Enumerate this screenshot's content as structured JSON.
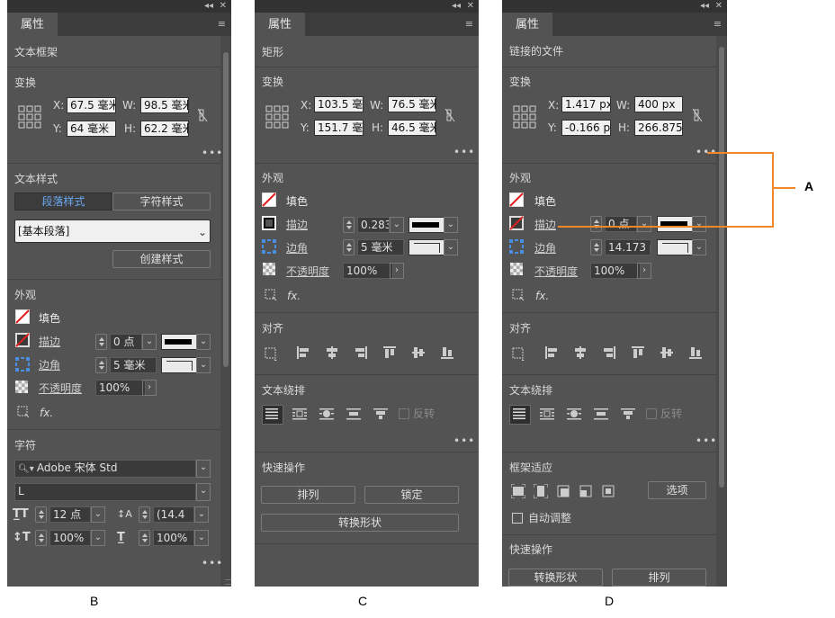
{
  "panels": {
    "b": {
      "tab": "属性",
      "object_type": "文本框架",
      "transform_label": "变换",
      "x_label": "X:",
      "x_value": "67.5 毫米",
      "y_label": "Y:",
      "y_value": "64 毫米",
      "w_label": "W:",
      "w_value": "98.5 毫米",
      "h_label": "H:",
      "h_value": "62.2 毫米",
      "more": "•••",
      "text_style_label": "文本样式",
      "para_style_tab": "段落样式",
      "char_style_tab": "字符样式",
      "style_value": "[基本段落]",
      "create_style_button": "创建样式",
      "appearance_label": "外观",
      "fill_label": "填色",
      "stroke_label": "描边",
      "stroke_value": "0 点",
      "corner_label": "边角",
      "corner_value": "5 毫米",
      "opacity_label": "不透明度",
      "opacity_value": "100%",
      "fx": "fx.",
      "character_label": "字符",
      "font_family": "Adobe 宋体 Std",
      "font_style": "L",
      "font_size": "12 点",
      "leading": "(14.4",
      "vertical_scale": "100%",
      "horizontal_scale": "100%"
    },
    "c": {
      "tab": "属性",
      "object_type": "矩形",
      "transform_label": "变换",
      "x_label": "X:",
      "x_value": "103.5 毫",
      "y_label": "Y:",
      "y_value": "151.7 毫",
      "w_label": "W:",
      "w_value": "76.5 毫米",
      "h_label": "H:",
      "h_value": "46.5 毫米",
      "more": "•••",
      "appearance_label": "外观",
      "fill_label": "填色",
      "stroke_label": "描边",
      "stroke_value": "0.283",
      "corner_label": "边角",
      "corner_value": "5 毫米",
      "opacity_label": "不透明度",
      "opacity_value": "100%",
      "fx": "fx.",
      "align_label": "对齐",
      "wrap_label": "文本绕排",
      "invert_label": "反转",
      "quick_actions_label": "快速操作",
      "arrange_button": "排列",
      "lock_button": "锁定",
      "convert_button": "转换形状"
    },
    "d": {
      "tab": "属性",
      "object_type": "链接的文件",
      "transform_label": "变换",
      "x_label": "X:",
      "x_value": "1.417 px",
      "y_label": "Y:",
      "y_value": "-0.166 p",
      "w_label": "W:",
      "w_value": "400 px",
      "h_label": "H:",
      "h_value": "266.875",
      "more": "•••",
      "appearance_label": "外观",
      "fill_label": "填色",
      "stroke_label": "描边",
      "stroke_value": "0 点",
      "corner_label": "边角",
      "corner_value": "14.173 p",
      "opacity_label": "不透明度",
      "opacity_value": "100%",
      "fx": "fx.",
      "align_label": "对齐",
      "wrap_label": "文本绕排",
      "invert_label": "反转",
      "frame_fit_label": "框架适应",
      "options_button": "选项",
      "auto_fit_label": "自动调整",
      "quick_actions_label": "快速操作",
      "convert_button": "转换形状",
      "arrange_button": "排列"
    }
  },
  "captions": {
    "b": "B",
    "c": "C",
    "d": "D",
    "callout": "A"
  },
  "window_controls": {
    "collapse": "◂◂",
    "close": "✕"
  },
  "colors": {
    "panel_bg": "#535353",
    "field_bg": "#f0f0f0",
    "accent_blue": "#4a90e2",
    "callout_orange": "#f0882a"
  }
}
